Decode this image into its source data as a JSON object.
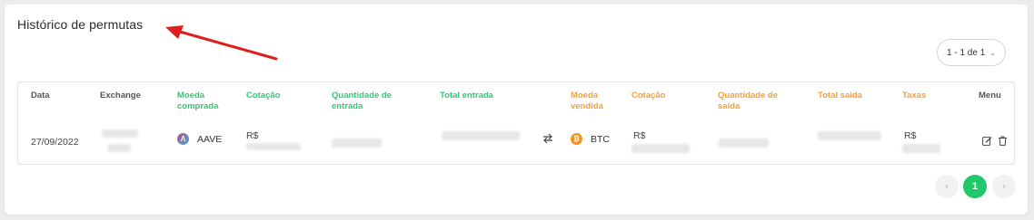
{
  "title": "Histórico de permutas",
  "range": {
    "label": "1 - 1 de 1"
  },
  "columns": {
    "data": "Data",
    "exchange": "Exchange",
    "moeda_comprada": "Moeda comprada",
    "cotacao_in": "Cotação",
    "quantidade_entrada": "Quantidade de entrada",
    "total_entrada": "Total entrada",
    "moeda_vendida": "Moeda vendida",
    "cotacao_out": "Cotação",
    "quantidade_saida": "Quantidade de saída",
    "total_saida": "Total saída",
    "taxas": "Taxas",
    "menu": "Menu"
  },
  "row": {
    "date": "27/09/2022",
    "coin_in": "AAVE",
    "cotacao_in_prefix": "R$",
    "coin_out": "BTC",
    "cotacao_out_prefix": "R$",
    "taxas_prefix": "R$"
  },
  "pagination": {
    "prev": "‹",
    "current": "1",
    "next": "›"
  },
  "colors": {
    "green": "#2fcb6f",
    "orange": "#f7a034",
    "arrow": "#e01e1e"
  },
  "icons": [
    "swap-icon",
    "edit-icon",
    "trash-icon",
    "aave-icon",
    "bitcoin-icon",
    "chevron-down-icon",
    "arrow-annotation"
  ]
}
